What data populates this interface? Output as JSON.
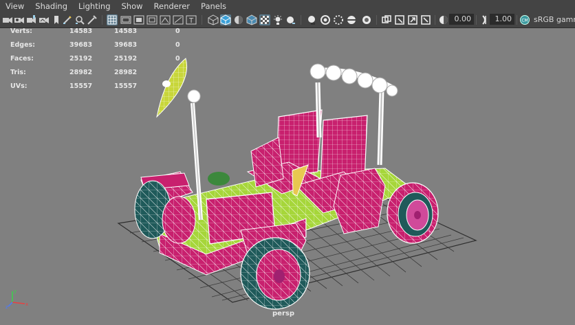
{
  "menu": [
    "View",
    "Shading",
    "Lighting",
    "Show",
    "Renderer",
    "Panels"
  ],
  "toolbar": {
    "exposure_value": "0.00",
    "gamma_value": "1.00",
    "color_space_label": "sRGB gamm",
    "icons": [
      "camera-select-icon",
      "camera-attributes-icon",
      "bookmark-icon",
      "image-plane-icon",
      "grease-pencil-icon",
      "2d-pan-zoom-icon",
      "grid-icon",
      "film-gate-icon",
      "resolution-gate-icon",
      "gate-mask-icon",
      "field-chart-icon",
      "safe-action-icon",
      "safe-title-icon",
      "wireframe-icon",
      "smooth-shade-icon",
      "use-default-material-icon",
      "wireframe-on-shaded-icon",
      "xray-icon",
      "textured-icon",
      "use-all-lights-icon",
      "shadows-icon",
      "screen-space-ao-icon",
      "motion-blur-icon",
      "multisample-aa-icon",
      "depth-of-field-icon",
      "isolate-select-icon",
      "xray-joints-icon",
      "xray-active-components-icon",
      "exposure-icon",
      "gamma-icon",
      "color-management-icon"
    ]
  },
  "hud": {
    "rows": [
      {
        "label": "Verts:",
        "v1": "14583",
        "v2": "14583",
        "v3": "0"
      },
      {
        "label": "Edges:",
        "v1": "39683",
        "v2": "39683",
        "v3": "0"
      },
      {
        "label": "Faces:",
        "v1": "25192",
        "v2": "25192",
        "v3": "0"
      },
      {
        "label": "Tris:",
        "v1": "28982",
        "v2": "28982",
        "v3": ""
      },
      {
        "label": "UVs:",
        "v1": "15557",
        "v2": "15557",
        "v3": ""
      }
    ]
  },
  "viewport": {
    "camera": "persp",
    "colors": {
      "magenta": "#c8206e",
      "lime": "#a6d63a",
      "teal": "#1f5a5a",
      "white": "#f2f2f2",
      "grid": "#3a3a3a"
    }
  }
}
